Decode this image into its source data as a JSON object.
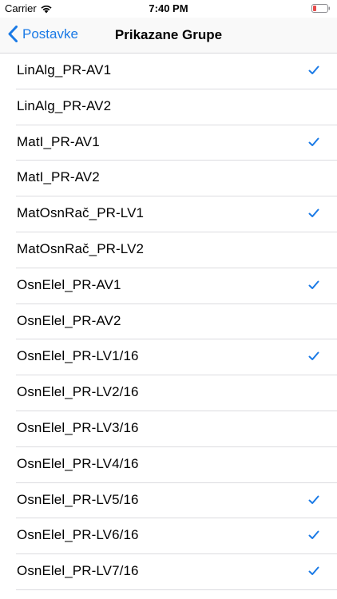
{
  "status_bar": {
    "carrier": "Carrier",
    "time": "7:40 PM",
    "battery_color": "#e64b4b"
  },
  "nav": {
    "back_label": "Postavke",
    "title": "Prikazane Grupe",
    "accent": "#1a7ae6"
  },
  "groups": [
    {
      "label": "LinAlg_PR-AV1",
      "checked": true
    },
    {
      "label": "LinAlg_PR-AV2",
      "checked": false
    },
    {
      "label": "MatI_PR-AV1",
      "checked": true
    },
    {
      "label": "MatI_PR-AV2",
      "checked": false
    },
    {
      "label": "MatOsnRač_PR-LV1",
      "checked": true
    },
    {
      "label": "MatOsnRač_PR-LV2",
      "checked": false
    },
    {
      "label": "OsnElel_PR-AV1",
      "checked": true
    },
    {
      "label": "OsnElel_PR-AV2",
      "checked": false
    },
    {
      "label": "OsnElel_PR-LV1/16",
      "checked": true
    },
    {
      "label": "OsnElel_PR-LV2/16",
      "checked": false
    },
    {
      "label": "OsnElel_PR-LV3/16",
      "checked": false
    },
    {
      "label": "OsnElel_PR-LV4/16",
      "checked": false
    },
    {
      "label": "OsnElel_PR-LV5/16",
      "checked": true
    },
    {
      "label": "OsnElel_PR-LV6/16",
      "checked": true
    },
    {
      "label": "OsnElel_PR-LV7/16",
      "checked": true
    }
  ]
}
